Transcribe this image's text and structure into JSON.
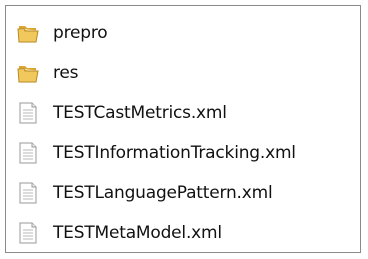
{
  "items": [
    {
      "name": "prepro",
      "type": "folder",
      "icon": "folder-icon"
    },
    {
      "name": "res",
      "type": "folder",
      "icon": "folder-icon"
    },
    {
      "name": "TESTCastMetrics.xml",
      "type": "file",
      "icon": "xml-file-icon"
    },
    {
      "name": "TESTInformationTracking.xml",
      "type": "file",
      "icon": "xml-file-icon"
    },
    {
      "name": "TESTLanguagePattern.xml",
      "type": "file",
      "icon": "xml-file-icon"
    },
    {
      "name": "TESTMetaModel.xml",
      "type": "file",
      "icon": "xml-file-icon"
    }
  ],
  "colors": {
    "folder_yellow": "#E8B84A",
    "folder_shade": "#D4A23A",
    "file_border": "#9A9A9A",
    "text": "#111111",
    "frame_border": "#8A8A8A"
  }
}
